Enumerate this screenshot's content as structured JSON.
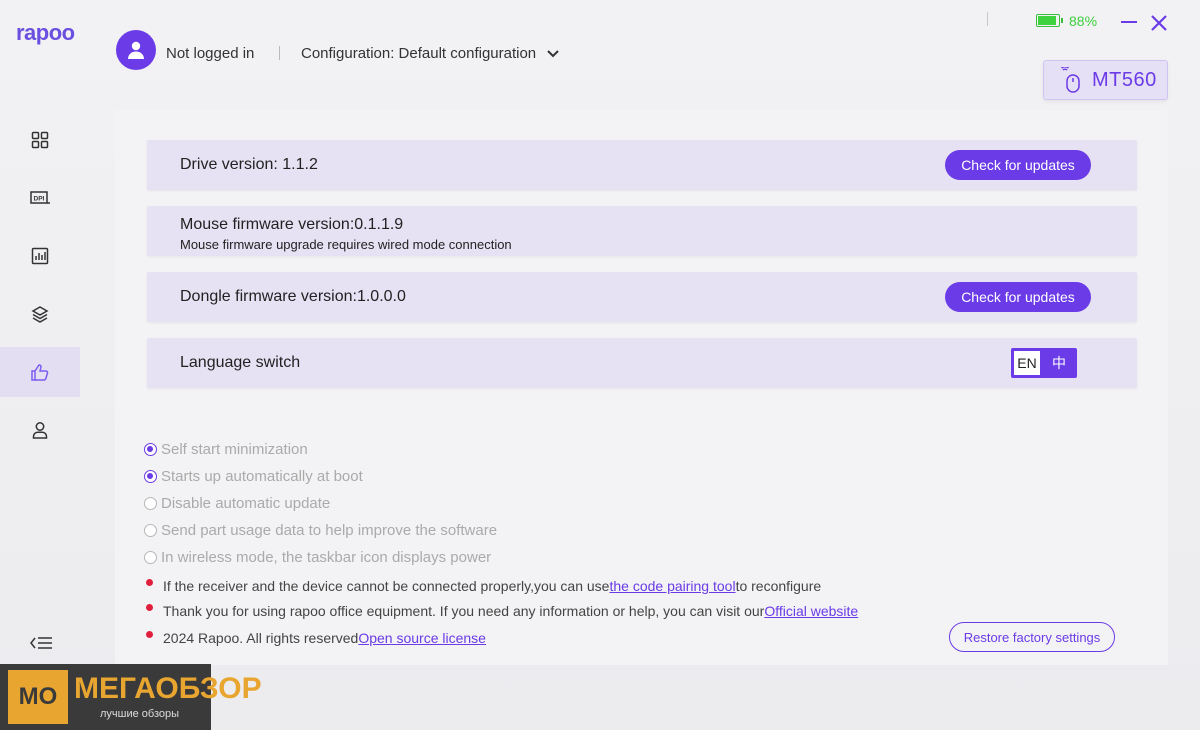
{
  "app": {
    "logo": "rapoo"
  },
  "header": {
    "user_name": "Not logged in",
    "configuration": "Configuration: Default configuration"
  },
  "window": {
    "battery_percent_label": "88%",
    "battery_level": 0.88
  },
  "device": {
    "name": "MT560"
  },
  "sidebar": {
    "items": [
      {
        "icon": "grid-icon"
      },
      {
        "icon": "dpi-icon"
      },
      {
        "icon": "chart-icon"
      },
      {
        "icon": "layers-icon"
      },
      {
        "icon": "thumbs-up-icon",
        "active": true
      },
      {
        "icon": "user-icon"
      }
    ]
  },
  "settings": {
    "drive_version": "Drive version: 1.1.2",
    "check_updates": "Check for updates",
    "mouse_firmware": "Mouse firmware version:0.1.1.9",
    "mouse_firmware_note": "Mouse firmware upgrade requires wired mode connection",
    "dongle_firmware": "Dongle firmware version:1.0.0.0",
    "language_switch": "Language switch",
    "lang_en": "EN",
    "lang_zh": "中"
  },
  "options": [
    {
      "label": "Self start minimization",
      "checked": true
    },
    {
      "label": "Starts up automatically at boot",
      "checked": true
    },
    {
      "label": "Disable automatic update",
      "checked": false
    },
    {
      "label": "Send part usage data to help improve the software",
      "checked": false
    },
    {
      "label": "In wireless mode, the taskbar icon displays power",
      "checked": false
    }
  ],
  "notes": {
    "pairing_before": "If the receiver and the device cannot be connected properly,you can use",
    "pairing_link": "the code pairing tool",
    "pairing_after": "to reconfigure",
    "help_before": "Thank you for using rapoo office equipment. If you need any information or help, you can visit our",
    "help_link": "Official website",
    "copyright": "2024 Rapoo. All rights reserved",
    "license_link": "Open source license"
  },
  "restore_button": "Restore factory settings",
  "watermark": {
    "mark": "MO",
    "brand": "МЕГАОБЗОР",
    "subtitle": "лучшие обзоры"
  },
  "colors": {
    "accent": "#6a3be6",
    "battery": "#3ed23e",
    "row_bg": "#e6e2f4",
    "note_dot": "#e01f3d"
  }
}
